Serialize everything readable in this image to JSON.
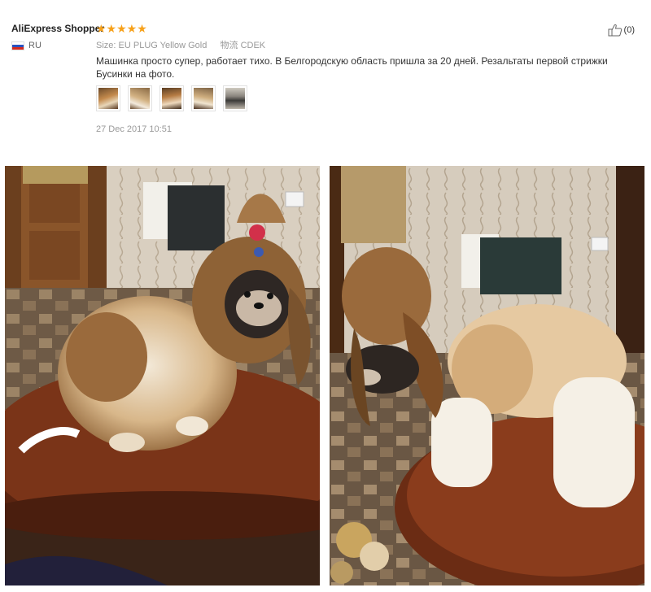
{
  "review": {
    "user_name": "AliExpress Shopper",
    "country": "RU",
    "rating": 5,
    "stars": "★★★★★",
    "size_label": "Size:",
    "size_value": "EU PLUG Yellow Gold",
    "shipping_label": "物流",
    "shipping_value": "CDEK",
    "helpful_count": "(0)",
    "text": "Машинка просто супер, работает тихо. В Белгородскую область пришла за 20 дней. Резальтаты первой стрижки Бусинки на фото.",
    "date": "27 Dec 2017 10:51",
    "photo_thumbnails": [
      "photo-1",
      "photo-2",
      "photo-3",
      "photo-4",
      "photo-5"
    ]
  },
  "colors": {
    "star": "#f7a11a",
    "meta_text": "#999999",
    "body_text": "#333333"
  },
  "icons": {
    "helpful": "thumbs-up-icon",
    "flag": "russia-flag-icon"
  }
}
